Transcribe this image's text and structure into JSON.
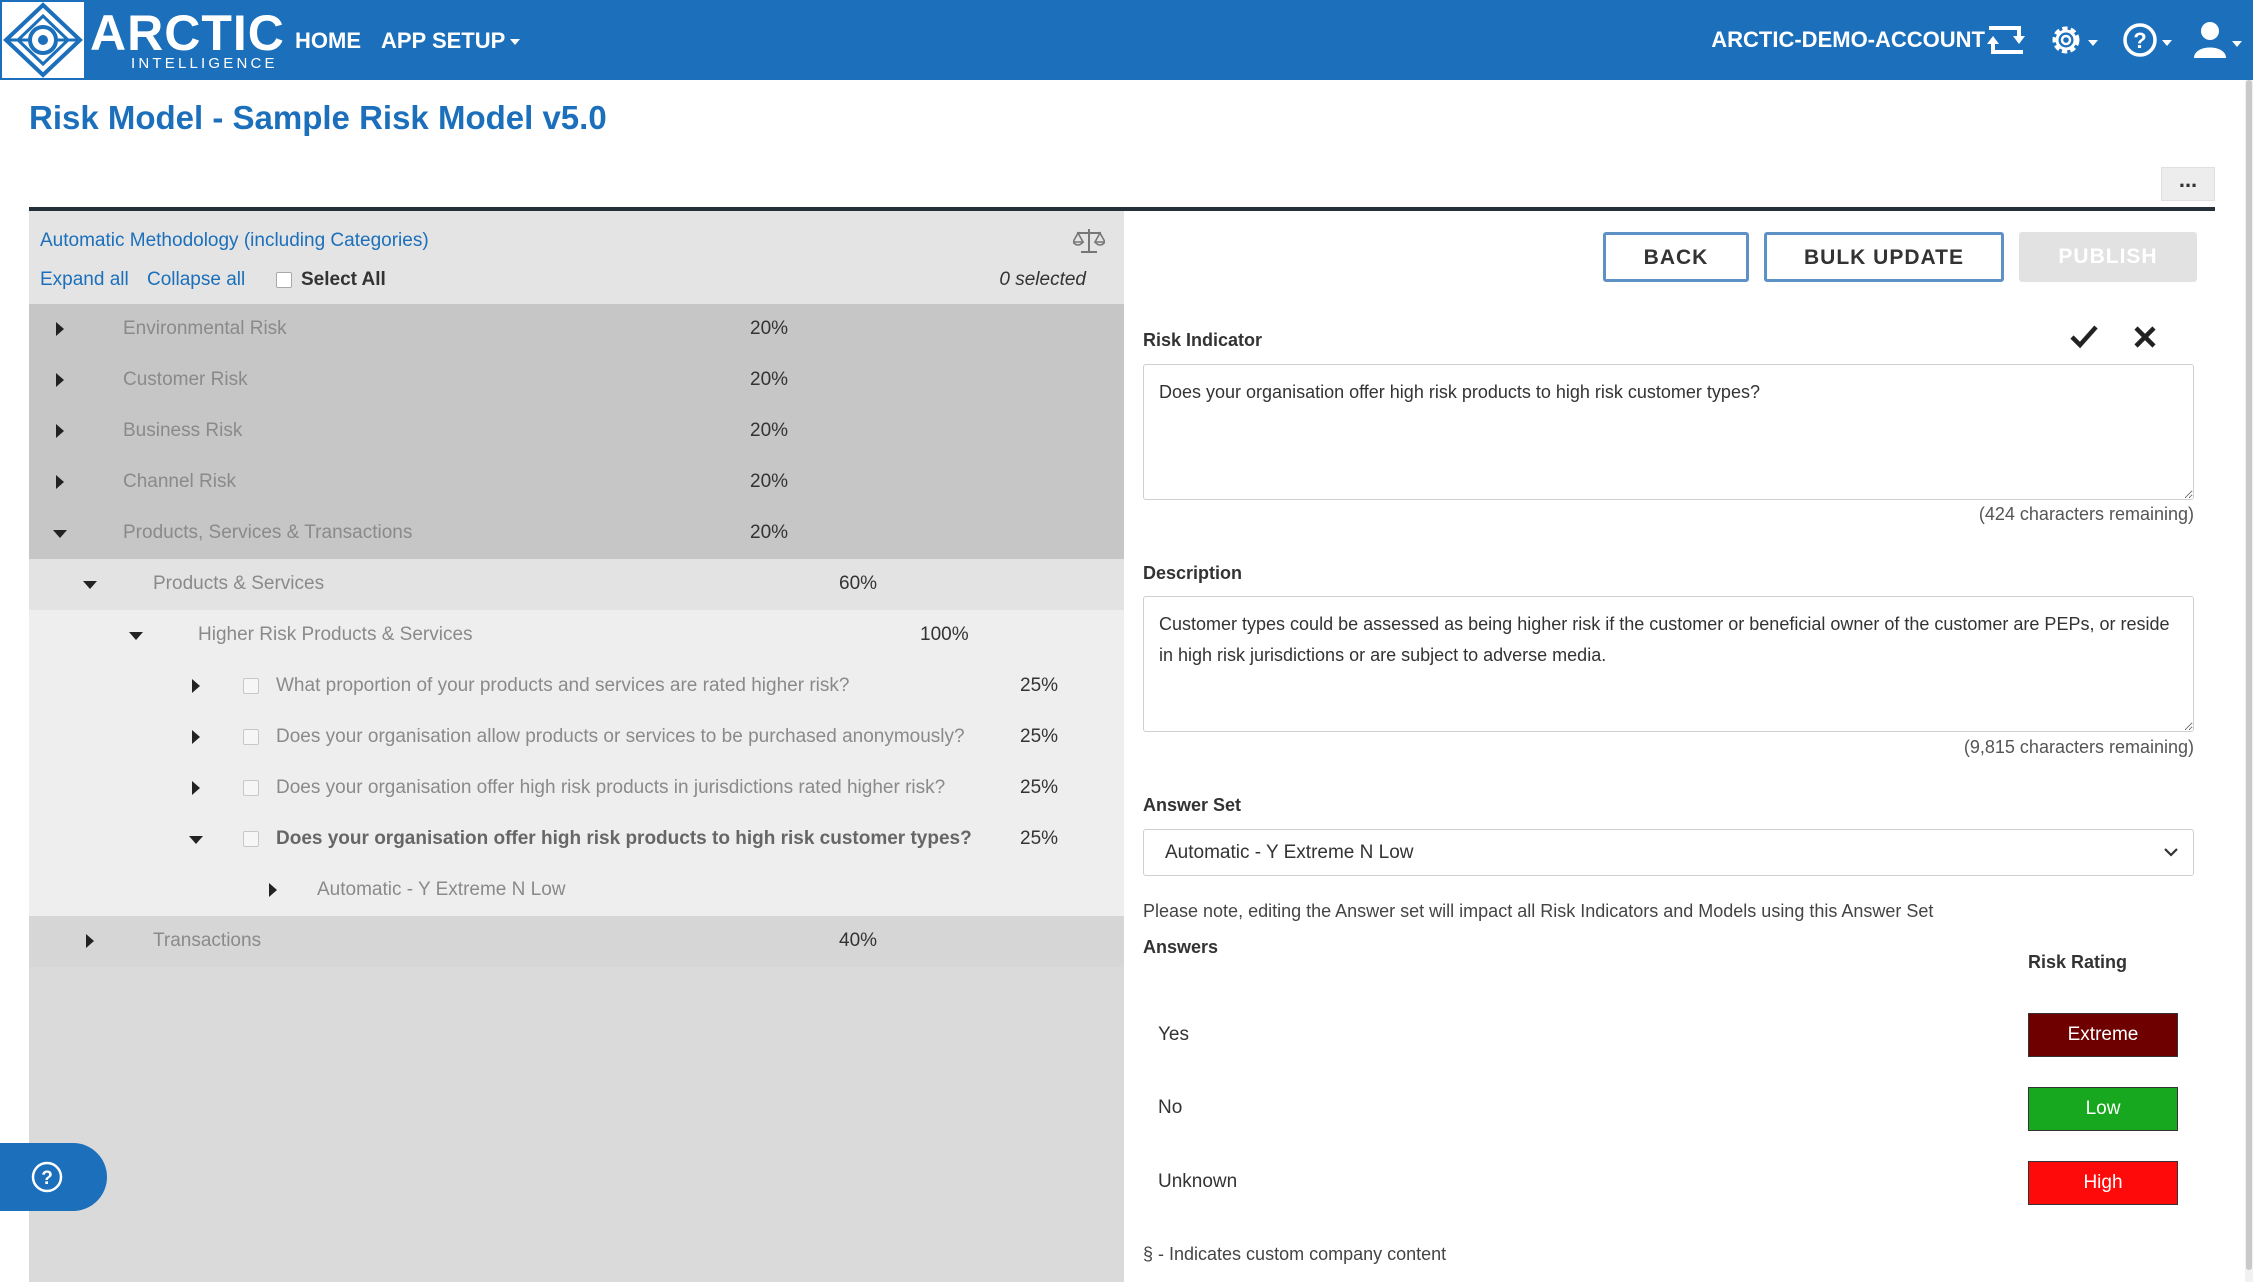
{
  "nav": {
    "brand_name": "ARCTIC",
    "brand_sub": "INTELLIGENCE",
    "home": "HOME",
    "app_setup": "APP SETUP",
    "account": "ARCTIC-DEMO-ACCOUNT",
    "icons": [
      "switch-account-icon",
      "gear-icon",
      "help-icon",
      "user-icon"
    ]
  },
  "page": {
    "title": "Risk Model - Sample Risk Model v5.0",
    "more": "..."
  },
  "tree": {
    "methodology": "Automatic Methodology (including Categories)",
    "expand_all": "Expand all",
    "collapse_all": "Collapse all",
    "select_all": "Select All",
    "selected_count": "0 selected",
    "rows": [
      {
        "label": "Environmental Risk",
        "pct": "20%"
      },
      {
        "label": "Customer Risk",
        "pct": "20%"
      },
      {
        "label": "Business Risk",
        "pct": "20%"
      },
      {
        "label": "Channel Risk",
        "pct": "20%"
      },
      {
        "label": "Products, Services & Transactions",
        "pct": "20%"
      },
      {
        "label": "Products & Services",
        "pct": "60%"
      },
      {
        "label": "Higher Risk Products & Services",
        "pct": "100%"
      },
      {
        "label": "What proportion of your products and services are rated higher risk?",
        "pct": "25%"
      },
      {
        "label": "Does your organisation allow products or services to be purchased anonymously?",
        "pct": "25%"
      },
      {
        "label": "Does your organisation offer high risk products in jurisdictions rated higher risk?",
        "pct": "25%"
      },
      {
        "label": "Does your organisation offer high risk products to high risk customer types?",
        "pct": "25%"
      },
      {
        "label": "Automatic - Y Extreme N Low",
        "pct": ""
      },
      {
        "label": "Transactions",
        "pct": "40%"
      }
    ]
  },
  "actions": {
    "back": "BACK",
    "bulk_update": "BULK UPDATE",
    "publish": "PUBLISH"
  },
  "form": {
    "risk_indicator_label": "Risk Indicator",
    "risk_indicator_value": "Does your organisation offer high risk products to high risk customer types?",
    "risk_indicator_remaining": "(424 characters remaining)",
    "description_label": "Description",
    "description_value": "Customer types could be assessed as being higher risk if the customer or beneficial owner of the customer are PEPs, or reside in high risk jurisdictions or are subject to adverse media.",
    "description_remaining": "(9,815 characters remaining)",
    "answer_set_label": "Answer Set",
    "answer_set_value": "Automatic - Y Extreme N Low",
    "answer_set_note": "Please note, editing the Answer set will impact all Risk Indicators and Models using this Answer Set",
    "answers_label": "Answers",
    "risk_rating_label": "Risk Rating",
    "answers": [
      {
        "answer": "Yes",
        "rating": "Extreme",
        "color": "#6e0000"
      },
      {
        "answer": "No",
        "rating": "Low",
        "color": "#18a81f"
      },
      {
        "answer": "Unknown",
        "rating": "High",
        "color": "#ff0a0a"
      }
    ],
    "footnote": "§ - Indicates custom company content"
  },
  "colors": {
    "brand": "#1b6fbb",
    "button_border": "#5e92c6"
  }
}
